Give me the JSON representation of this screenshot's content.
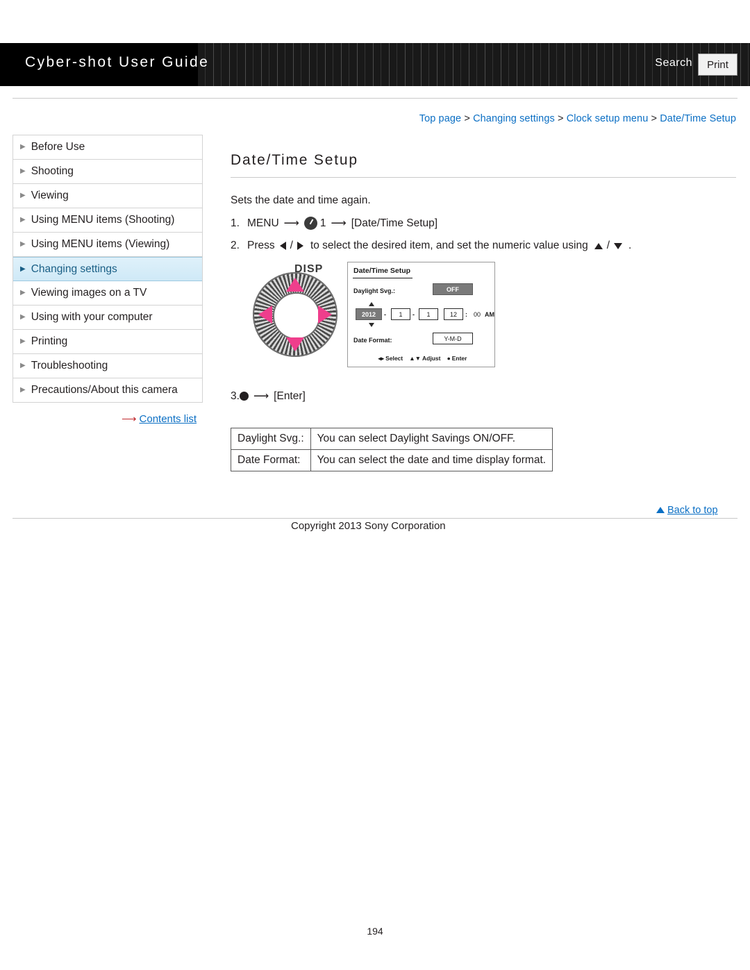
{
  "header": {
    "title": "Cyber-shot User Guide",
    "search_label": "Search",
    "print_label": "Print"
  },
  "breadcrumb": {
    "items": [
      "Top page",
      "Changing settings",
      "Clock setup menu",
      "Date/Time Setup"
    ],
    "separator": ">"
  },
  "sidebar": {
    "items": [
      {
        "label": "Before Use",
        "selected": false
      },
      {
        "label": "Shooting",
        "selected": false
      },
      {
        "label": "Viewing",
        "selected": false
      },
      {
        "label": "Using MENU items (Shooting)",
        "selected": false
      },
      {
        "label": "Using MENU items (Viewing)",
        "selected": false
      },
      {
        "label": "Changing settings",
        "selected": true
      },
      {
        "label": "Viewing images on a TV",
        "selected": false
      },
      {
        "label": "Using with your computer",
        "selected": false
      },
      {
        "label": "Printing",
        "selected": false
      },
      {
        "label": "Troubleshooting",
        "selected": false
      },
      {
        "label": "Precautions/About this camera",
        "selected": false
      }
    ],
    "contents_list_label": "Contents list"
  },
  "main": {
    "title": "Date/Time Setup",
    "intro": "Sets the date and time again.",
    "step1": {
      "number": "1.",
      "text_before": "MENU",
      "menu_icon_number": "1",
      "text_after": "[Date/Time Setup]"
    },
    "step2": {
      "number": "2.",
      "text_a": "Press",
      "text_b": "/",
      "text_c": "to select the desired item, and set the numeric value using",
      "text_d": "/",
      "text_e": "."
    },
    "step3": {
      "number": "3.",
      "text": "[Enter]"
    },
    "figure": {
      "disp_label": "DISP",
      "lcd": {
        "title": "Date/Time Setup",
        "daylight_label": "Daylight Svg.:",
        "daylight_value": "OFF",
        "year": "2012",
        "month": "1",
        "day": "1",
        "hour": "12",
        "minute": "00",
        "meridiem": "AM",
        "date_sep": "-",
        "time_sep": ":",
        "date_format_label": "Date Format:",
        "date_format_value": "Y-M-D",
        "footer_select": "Select",
        "footer_adjust": "Adjust",
        "footer_enter": "Enter"
      }
    },
    "table": {
      "rows": [
        {
          "key": "Daylight Svg.:",
          "value": "You can select Daylight Savings ON/OFF."
        },
        {
          "key": "Date Format:",
          "value": "You can select the date and time display format."
        }
      ]
    }
  },
  "footer": {
    "back_to_top": "Back to top",
    "copyright": "Copyright 2013 Sony Corporation",
    "page_number": "194"
  }
}
